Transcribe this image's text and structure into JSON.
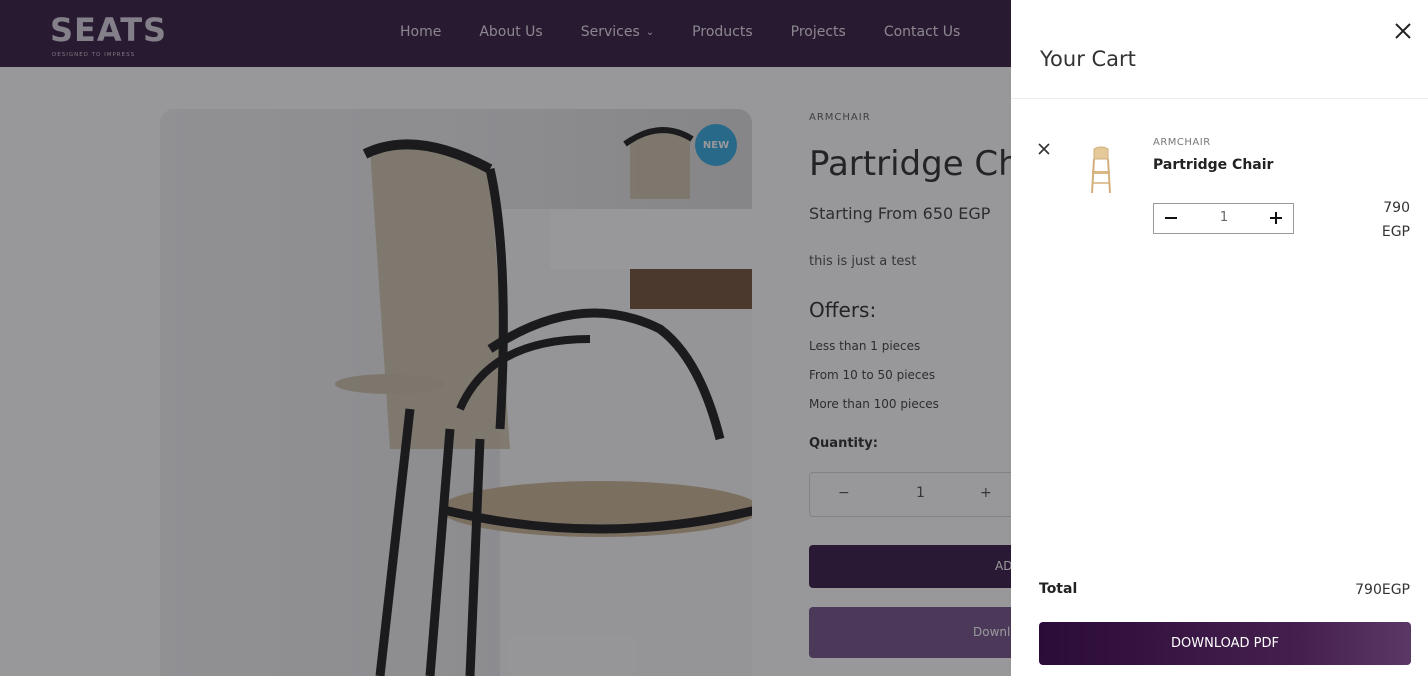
{
  "header": {
    "logo_text": "SEATS",
    "logo_tagline": "DESIGNED TO IMPRESS",
    "nav": [
      {
        "label": "Home"
      },
      {
        "label": "About Us"
      },
      {
        "label": "Services"
      },
      {
        "label": "Products"
      },
      {
        "label": "Projects"
      },
      {
        "label": "Contact Us"
      }
    ]
  },
  "product": {
    "badge": "NEW",
    "category": "ARMCHAIR",
    "title": "Partridge Chair",
    "starting_from": "Starting From 650 EGP",
    "description": "this is just a test",
    "offers_title": "Offers:",
    "offers": [
      "Less than 1 pieces",
      "From 10 to 50 pieces",
      "More than 100 pieces"
    ],
    "quantity_label": "Quantity:",
    "quantity": "1",
    "minus": "−",
    "plus": "+",
    "add_label": "ADD TO CART",
    "download_label": "Download PDF"
  },
  "cart": {
    "title": "Your Cart",
    "item": {
      "category": "ARMCHAIR",
      "name": "Partridge Chair",
      "quantity": "1",
      "price_amount": "790",
      "price_currency": "EGP"
    },
    "total_label": "Total",
    "total_value": "790EGP",
    "download_button": "DOWNLOAD PDF"
  }
}
